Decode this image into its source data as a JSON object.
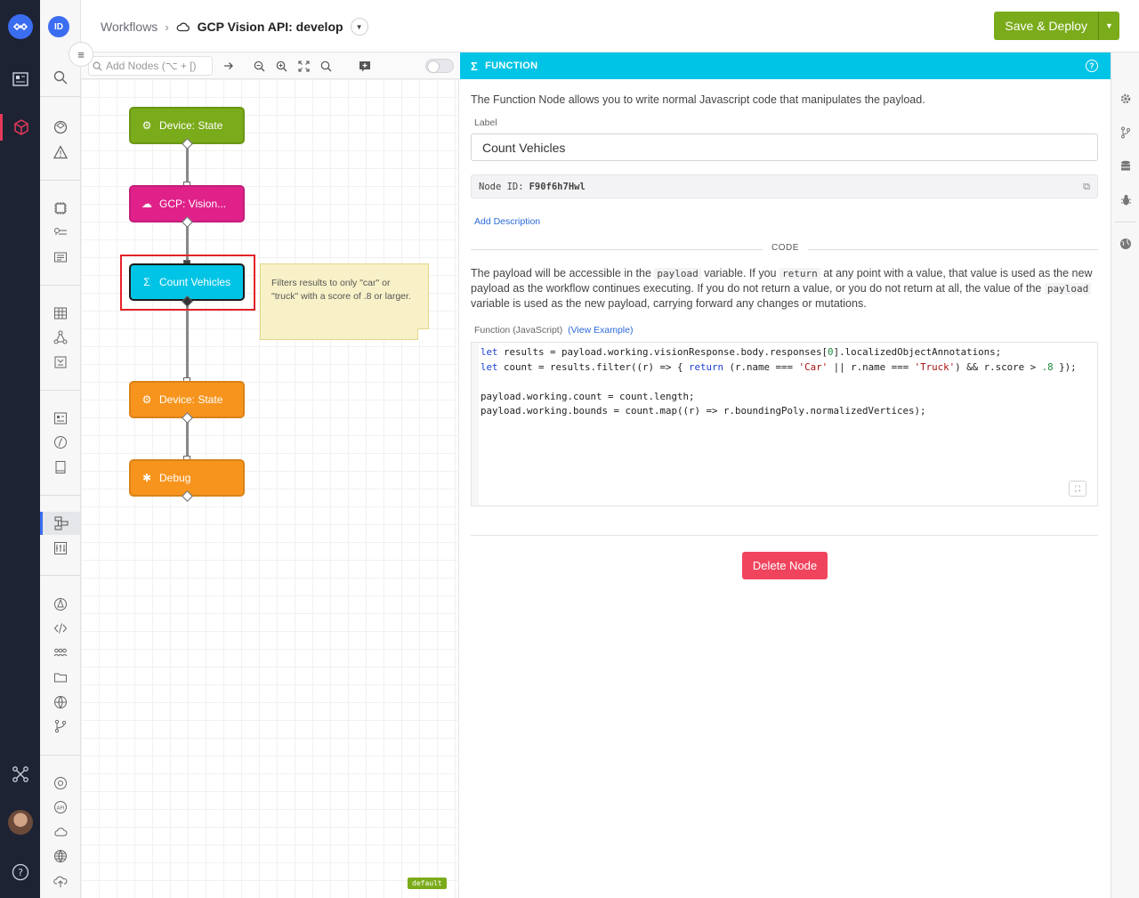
{
  "header": {
    "avatar_initials": "ID",
    "breadcrumb_root": "Workflows",
    "breadcrumb_separator": "›",
    "workflow_name": "GCP Vision API: develop",
    "deploy_label": "Save & Deploy"
  },
  "toolbar": {
    "add_nodes_placeholder": "Add Nodes (⌥ + [)"
  },
  "canvas": {
    "nodes": [
      {
        "label": "Device: State",
        "color": "#7aab1a",
        "icon": "device-icon"
      },
      {
        "label": "GCP: Vision...",
        "color": "#e0218a",
        "icon": "cloud-icon"
      },
      {
        "label": "Count Vehicles",
        "color": "#00c4e6",
        "icon": "sigma-icon",
        "selected": true
      },
      {
        "label": "Device: State",
        "color": "#f7941d",
        "icon": "device-icon"
      },
      {
        "label": "Debug",
        "color": "#f7941d",
        "icon": "bug-icon"
      }
    ],
    "note_text": "Filters results to only \"car\" or \"truck\" with a score of .8 or larger.",
    "default_tag": "default"
  },
  "panel": {
    "title": "FUNCTION",
    "description": "The Function Node allows you to write normal Javascript code that manipulates the payload.",
    "label_caption": "Label",
    "label_value": "Count Vehicles",
    "node_id_caption": "Node ID:",
    "node_id_value": "F90f6h7Hwl",
    "add_description": "Add Description",
    "section_title": "CODE",
    "code_desc_1": "The payload will be accessible in the ",
    "code_desc_var": "payload",
    "code_desc_2": " variable. If you ",
    "code_desc_return": "return",
    "code_desc_3": " at any point with a value, that value is used as the new payload as the workflow continues executing. If you do not return a value, or you do not return at all, the value of the ",
    "code_desc_var2": "payload",
    "code_desc_4": " variable is used as the new payload, carrying forward any changes or mutations.",
    "function_caption": "Function (JavaScript)",
    "view_example": "(View Example)",
    "delete_label": "Delete Node"
  },
  "colors": {
    "accent_cyan": "#00c4e6",
    "deploy_green": "#7aab1a",
    "delete_red": "#f0445e",
    "selection_red": "#e32228"
  }
}
